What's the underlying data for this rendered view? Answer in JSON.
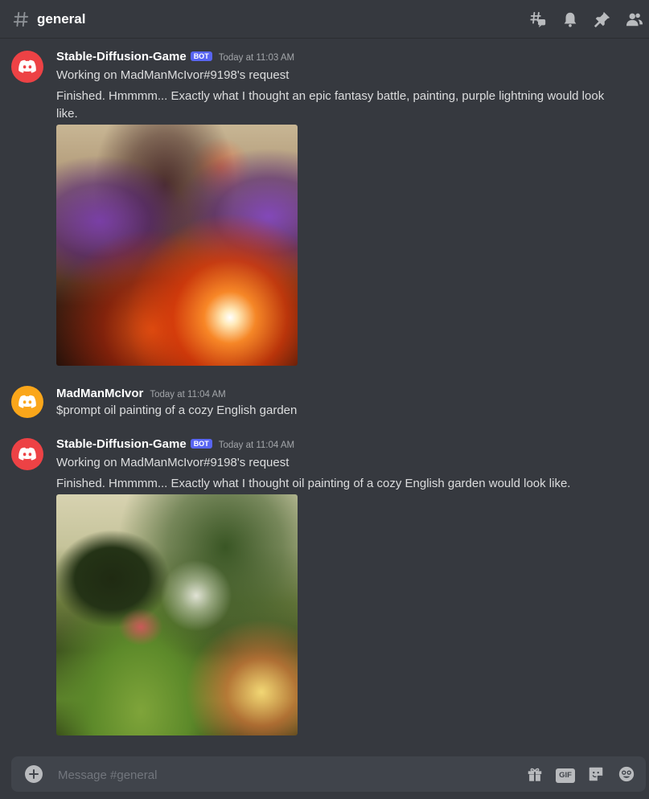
{
  "channel": {
    "name": "general"
  },
  "header_icons": [
    "threads-icon",
    "bell-icon",
    "pin-icon",
    "members-icon"
  ],
  "messages": [
    {
      "author": "Stable-Diffusion-Game",
      "bot_tag": "BOT",
      "timestamp": "Today at 11:03 AM",
      "avatar_color": "#ed4245",
      "lines": [
        "Working on MadManMcIvor#9198's request",
        "Finished. Hmmmm... Exactly what I thought an epic fantasy battle, painting, purple lightning would look like."
      ]
    },
    {
      "author": "MadManMcIvor",
      "timestamp": "Today at 11:04 AM",
      "avatar_color": "#faa61a",
      "lines": [
        "$prompt oil painting of a cozy English garden"
      ]
    },
    {
      "author": "Stable-Diffusion-Game",
      "bot_tag": "BOT",
      "timestamp": "Today at 11:04 AM",
      "avatar_color": "#ed4245",
      "lines": [
        "Working on MadManMcIvor#9198's request",
        "Finished. Hmmmm... Exactly what I thought oil painting of a cozy English garden would look like."
      ]
    }
  ],
  "composer": {
    "placeholder": "Message #general",
    "gif_label": "GIF",
    "icons": [
      "add-attachment-icon",
      "gift-icon",
      "gif-icon",
      "sticker-icon",
      "emoji-icon"
    ]
  },
  "colors": {
    "background": "#36393f",
    "composer": "#40444b",
    "accent": "#5865f2",
    "text": "#dcddde",
    "muted": "#a3a6aa"
  }
}
